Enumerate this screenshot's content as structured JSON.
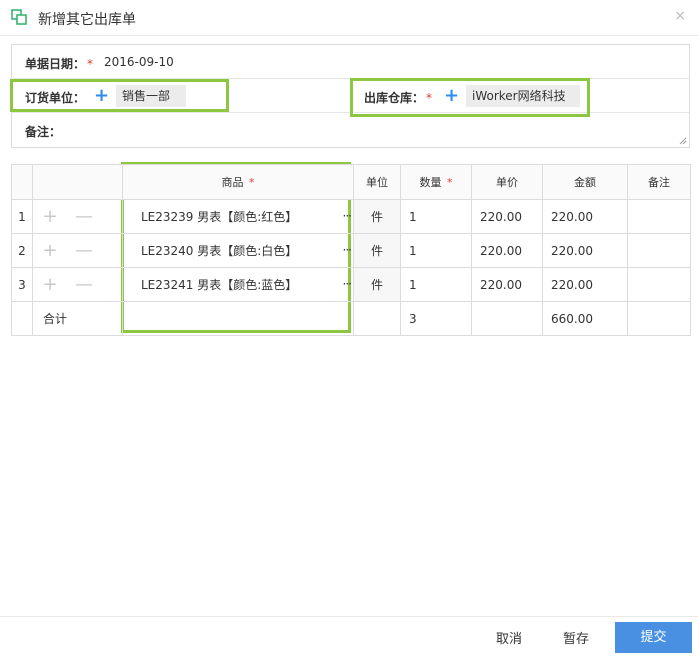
{
  "dialog": {
    "title": "新增其它出库单",
    "close": "×"
  },
  "form": {
    "date_label": "单据日期：",
    "date_value": "2016-09-10",
    "order_unit_label": "订货单位：",
    "order_unit_value": "销售一部",
    "warehouse_label": "出库仓库：",
    "warehouse_value": "iWorker网络科技",
    "remark_label": "备注：",
    "required_mark": "*",
    "plus": "+"
  },
  "grid": {
    "headers": {
      "goods": "商品",
      "unit": "单位",
      "qty": "数量",
      "price": "单价",
      "amount": "金额",
      "remark": "备注"
    },
    "required_mark": "*",
    "rows": [
      {
        "idx": "1",
        "goods": "LE23239 男表【颜色:红色】",
        "unit": "件",
        "qty": "1",
        "price": "220.00",
        "amount": "220.00"
      },
      {
        "idx": "2",
        "goods": "LE23240 男表【颜色:白色】",
        "unit": "件",
        "qty": "1",
        "price": "220.00",
        "amount": "220.00"
      },
      {
        "idx": "3",
        "goods": "LE23241 男表【颜色:蓝色】",
        "unit": "件",
        "qty": "1",
        "price": "220.00",
        "amount": "220.00"
      }
    ],
    "total": {
      "label": "合计",
      "qty": "3",
      "amount": "660.00"
    },
    "op_plus": "+",
    "op_minus": "—",
    "dots": "···"
  },
  "footer": {
    "cancel": "取消",
    "save_draft": "暂存",
    "submit": "提交"
  },
  "colors": {
    "accent": "#4a90e2",
    "highlight": "#8dc63f",
    "required": "#e53935"
  }
}
